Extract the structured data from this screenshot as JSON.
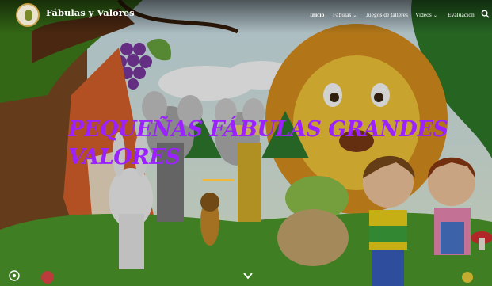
{
  "site": {
    "title": "Fábulas y Valores"
  },
  "nav": {
    "items": [
      {
        "label": "Inicio",
        "active": true,
        "has_dropdown": false
      },
      {
        "label": "Fábulas",
        "active": false,
        "has_dropdown": true
      },
      {
        "label": "Juegos de talleres",
        "active": false,
        "has_dropdown": false
      },
      {
        "label": "Videos",
        "active": false,
        "has_dropdown": true
      },
      {
        "label": "Evaluación",
        "active": false,
        "has_dropdown": false
      }
    ],
    "dropdown_glyph": "⌄"
  },
  "hero": {
    "headline_line1": "PEQUEÑAS FÁBULAS GRANDES",
    "headline_line2": "VALORES"
  },
  "icons": [
    "logo",
    "search-icon",
    "chevron-down-icon",
    "scroll-down-icon",
    "gear-icon"
  ],
  "colors": {
    "headline": "#9b22ff",
    "divider": "#f2b63a",
    "nav_text": "#ffffff"
  }
}
